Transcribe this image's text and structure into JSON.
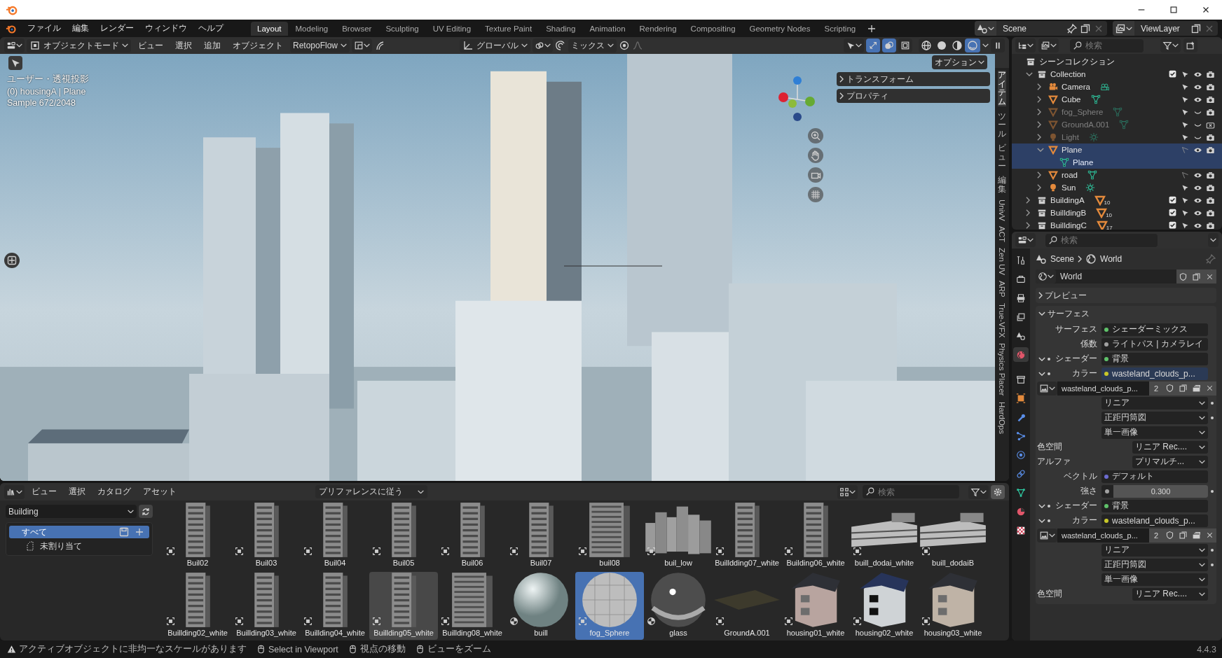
{
  "top_bar": {
    "menus": [
      "ファイル",
      "編集",
      "レンダー",
      "ウィンドウ",
      "ヘルプ"
    ],
    "workspaces": [
      {
        "label": "Layout",
        "selected": true
      },
      {
        "label": "Modeling",
        "selected": false
      },
      {
        "label": "Browser",
        "selected": false
      },
      {
        "label": "Sculpting",
        "selected": false
      },
      {
        "label": "UV Editing",
        "selected": false
      },
      {
        "label": "Texture Paint",
        "selected": false
      },
      {
        "label": "Shading",
        "selected": false
      },
      {
        "label": "Animation",
        "selected": false
      },
      {
        "label": "Rendering",
        "selected": false
      },
      {
        "label": "Compositing",
        "selected": false
      },
      {
        "label": "Geometry Nodes",
        "selected": false
      },
      {
        "label": "Scripting",
        "selected": false
      }
    ],
    "scene": "Scene",
    "view_layer": "ViewLayer"
  },
  "viewport": {
    "header": {
      "mode": "オブジェクトモード",
      "menus": [
        "ビュー",
        "選択",
        "追加",
        "オブジェクト"
      ],
      "addon": "RetopoFlow",
      "orientation": "グローバル",
      "snap": "ミックス",
      "toggles": [
        {
          "kind": "gizmo",
          "on": true
        },
        {
          "kind": "overlay",
          "on": true
        },
        {
          "kind": "xray",
          "on": false
        }
      ],
      "shading": [
        {
          "kind": "wireframe",
          "selected": false
        },
        {
          "kind": "solid",
          "selected": false
        },
        {
          "kind": "material",
          "selected": false
        },
        {
          "kind": "rendered",
          "selected": true
        }
      ]
    },
    "overlay_text": [
      "ユーザー・透視投影",
      "(0) housingA | Plane",
      "Sample 672/2048"
    ],
    "options_button": "オプション",
    "sidebar_panels": [
      {
        "title": "トランスフォーム",
        "expanded": false
      },
      {
        "title": "プロパティ",
        "expanded": false
      }
    ],
    "side_tabs": [
      {
        "label": "アイテム",
        "kind": "stacked",
        "selected": true
      },
      {
        "label": "ツール",
        "kind": "stacked",
        "selected": false
      },
      {
        "label": "ビュー",
        "kind": "stacked",
        "selected": false
      },
      {
        "label": "編集",
        "kind": "stacked",
        "selected": false
      },
      {
        "label": "UnivV",
        "kind": "rotated",
        "selected": false
      },
      {
        "label": "ACT",
        "kind": "rotated",
        "selected": false
      },
      {
        "label": "Zen UV",
        "kind": "rotated",
        "selected": false
      },
      {
        "label": "ARP",
        "kind": "rotated",
        "selected": false
      },
      {
        "label": "True-VFX",
        "kind": "rotated",
        "selected": false
      },
      {
        "label": "Physics Placer",
        "kind": "rotated",
        "selected": false
      },
      {
        "label": "HardOps",
        "kind": "rotated",
        "selected": false
      }
    ]
  },
  "asset_browser": {
    "menus": [
      "ビュー",
      "選択",
      "カタログ",
      "アセット"
    ],
    "import_method": "プリファレンスに従う",
    "search_placeholder": "検索",
    "library": "Building",
    "catalogs": [
      {
        "label": "すべて",
        "selected": true
      },
      {
        "label": "未割り当て",
        "selected": false
      }
    ],
    "assets": [
      {
        "name": "Buil02",
        "kind": "tower",
        "selected": false,
        "hovered": false
      },
      {
        "name": "Buil03",
        "kind": "tower",
        "selected": false,
        "hovered": false
      },
      {
        "name": "Buil04",
        "kind": "tower",
        "selected": false,
        "hovered": false
      },
      {
        "name": "Buil05",
        "kind": "tower",
        "selected": false,
        "hovered": false
      },
      {
        "name": "Buil06",
        "kind": "tower",
        "selected": false,
        "hovered": false
      },
      {
        "name": "Buil07",
        "kind": "tower",
        "selected": false,
        "hovered": false
      },
      {
        "name": "buil08",
        "kind": "block",
        "selected": false,
        "hovered": false
      },
      {
        "name": "buil_low",
        "kind": "cluster",
        "selected": false,
        "hovered": false
      },
      {
        "name": "Builldding07_white",
        "kind": "tower",
        "selected": false,
        "hovered": false
      },
      {
        "name": "Building06_white",
        "kind": "tower",
        "selected": false,
        "hovered": false
      },
      {
        "name": "buill_dodai_white",
        "kind": "wide",
        "selected": false,
        "hovered": false
      },
      {
        "name": "buill_dodaiB",
        "kind": "wide",
        "selected": false,
        "hovered": false
      },
      {
        "name": "Buillding02_white",
        "kind": "tower",
        "selected": false,
        "hovered": false
      },
      {
        "name": "Buillding03_white",
        "kind": "tower",
        "selected": false,
        "hovered": false
      },
      {
        "name": "Buillding04_white",
        "kind": "tower",
        "selected": false,
        "hovered": false
      },
      {
        "name": "Buillding05_white",
        "kind": "tower",
        "selected": false,
        "hovered": true
      },
      {
        "name": "Buillding08_white",
        "kind": "block",
        "selected": false,
        "hovered": false
      },
      {
        "name": "buill",
        "kind": "sphere",
        "selected": false,
        "hovered": false
      },
      {
        "name": "fog_Sphere",
        "kind": "faceted",
        "selected": true,
        "hovered": false
      },
      {
        "name": "glass",
        "kind": "glass",
        "selected": false,
        "hovered": false
      },
      {
        "name": "GroundA.001",
        "kind": "ground",
        "selected": false,
        "hovered": false
      },
      {
        "name": "housing01_white",
        "kind": "house_a",
        "selected": false,
        "hovered": false
      },
      {
        "name": "housing02_white",
        "kind": "house_b",
        "selected": false,
        "hovered": false
      },
      {
        "name": "housing03_white",
        "kind": "house_c",
        "selected": false,
        "hovered": false
      }
    ]
  },
  "outliner": {
    "search_placeholder": "検索",
    "tree": [
      {
        "name": "シーンコレクション",
        "kind": "scene_collection",
        "children": [
          {
            "name": "Collection",
            "kind": "collection",
            "expanded": true,
            "checked": true,
            "selected": false,
            "selectable": true,
            "visible": true,
            "renderable": true,
            "children": [
              {
                "name": "Camera",
                "kind": "camera",
                "data_icon": true,
                "expanded": false,
                "selected": false,
                "selectable": true,
                "visible": true,
                "renderable": true
              },
              {
                "name": "Cube",
                "kind": "mesh",
                "data_icon": true,
                "expanded": false,
                "selected": false,
                "selectable": true,
                "visible": true,
                "renderable": true
              },
              {
                "name": "fog_Sphere",
                "kind": "mesh",
                "data_icon": true,
                "expanded": false,
                "selected": false,
                "selectable": true,
                "visible": false,
                "renderable": true
              },
              {
                "name": "GroundA.001",
                "kind": "mesh",
                "data_icon": true,
                "expanded": false,
                "selected": false,
                "selectable": true,
                "visible": false,
                "renderable": false
              },
              {
                "name": "Light",
                "kind": "light",
                "data_icon": true,
                "expanded": false,
                "selected": false,
                "selectable": true,
                "visible": false,
                "renderable": true
              },
              {
                "name": "Plane",
                "kind": "mesh",
                "data_icon": false,
                "expanded": true,
                "selected": true,
                "selectable": false,
                "visible": true,
                "renderable": true,
                "children": [
                  {
                    "name": "Plane",
                    "kind": "mesh_data",
                    "selected": true
                  }
                ]
              },
              {
                "name": "road",
                "kind": "mesh",
                "data_icon": true,
                "expanded": false,
                "selected": false,
                "selectable": false,
                "visible": true,
                "renderable": true
              },
              {
                "name": "Sun",
                "kind": "light",
                "data_icon": true,
                "expanded": false,
                "selected": false,
                "selectable": true,
                "visible": true,
                "renderable": true
              }
            ]
          },
          {
            "name": "BuildingA",
            "kind": "collection",
            "count": "10",
            "expanded": false,
            "checked": true,
            "selected": false,
            "selectable": true,
            "visible": true,
            "renderable": true
          },
          {
            "name": "BuilldingB",
            "kind": "collection",
            "count": "10",
            "expanded": false,
            "checked": true,
            "selected": false,
            "selectable": true,
            "visible": true,
            "renderable": true
          },
          {
            "name": "BuilldingC",
            "kind": "collection",
            "count": "17",
            "expanded": false,
            "checked": true,
            "selected": false,
            "selectable": true,
            "visible": true,
            "renderable": true
          }
        ]
      }
    ]
  },
  "properties": {
    "search_placeholder": "検索",
    "tabs": [
      {
        "kind": "tool",
        "selected": false
      },
      {
        "kind": "render",
        "selected": false
      },
      {
        "kind": "output",
        "selected": false
      },
      {
        "kind": "view_layer",
        "selected": false
      },
      {
        "kind": "scene",
        "selected": false
      },
      {
        "kind": "world",
        "selected": true
      },
      {
        "kind": "collection",
        "selected": false
      },
      {
        "kind": "object",
        "selected": false
      },
      {
        "kind": "modifier",
        "selected": false
      },
      {
        "kind": "particles",
        "selected": false
      },
      {
        "kind": "physics",
        "selected": false
      },
      {
        "kind": "constraints",
        "selected": false
      },
      {
        "kind": "data",
        "selected": false
      },
      {
        "kind": "material",
        "selected": false
      },
      {
        "kind": "texture",
        "selected": false
      }
    ],
    "breadcrumb": [
      "Scene",
      "World"
    ],
    "world": "World",
    "panels": [
      {
        "title": "プレビュー",
        "expanded": false
      },
      {
        "title": "サーフェス",
        "expanded": true
      }
    ],
    "rows": [
      {
        "kind": "socket",
        "label": "サーフェス",
        "color": "#5fc26a",
        "value": "シェーダーミックス",
        "highlighted": false
      },
      {
        "kind": "socket",
        "label": "係数",
        "color": "#a1a1a1",
        "value": "ライトパス | カメラレイ",
        "highlighted": false
      },
      {
        "kind": "socket",
        "label": "シェーダー",
        "color": "#5fc26a",
        "value": "背景",
        "expanded": true,
        "highlighted": false
      },
      {
        "kind": "socket",
        "label": "カラー",
        "color": "#c7c729",
        "value": "wasteland_clouds_p...",
        "expanded": true,
        "highlighted": true
      },
      {
        "kind": "image",
        "value": "wasteland_clouds_p...",
        "users": "2"
      },
      {
        "kind": "dropdown",
        "value": "リニア",
        "animatable": true
      },
      {
        "kind": "dropdown",
        "value": "正距円筒図",
        "animatable": true
      },
      {
        "kind": "dropdown",
        "value": "単一画像",
        "animatable": false
      },
      {
        "kind": "labeled_dropdown",
        "label": "色空間",
        "value": "リニア Rec...."
      },
      {
        "kind": "labeled_dropdown",
        "label": "アルファ",
        "value": "プリマルチ..."
      },
      {
        "kind": "socket",
        "label": "ベクトル",
        "color": "#6c6cd0",
        "value": "デフォルト",
        "highlighted": false
      },
      {
        "kind": "number",
        "label": "強さ",
        "color": "#a1a1a1",
        "value": "0.300",
        "animatable": true
      },
      {
        "kind": "socket",
        "label": "シェーダー",
        "color": "#5fc26a",
        "value": "背景",
        "expanded": true,
        "highlighted": false
      },
      {
        "kind": "socket",
        "label": "カラー",
        "color": "#c7c729",
        "value": "wasteland_clouds_p...",
        "expanded": true,
        "highlighted": false
      },
      {
        "kind": "image",
        "value": "wasteland_clouds_p...",
        "users": "2"
      },
      {
        "kind": "dropdown",
        "value": "リニア",
        "animatable": true
      },
      {
        "kind": "dropdown",
        "value": "正距円筒図",
        "animatable": true
      },
      {
        "kind": "dropdown",
        "value": "単一画像",
        "animatable": false
      },
      {
        "kind": "labeled_dropdown",
        "label": "色空間",
        "value": "リニア Rec...."
      }
    ]
  },
  "status_bar": {
    "items": [
      {
        "kind": "warning",
        "text": "アクティブオブジェクトに非均一なスケールがあります"
      },
      {
        "kind": "mouse",
        "text": "Select in Viewport"
      },
      {
        "kind": "mouse",
        "text": "視点の移動"
      },
      {
        "kind": "mouse",
        "text": "ビューをズーム"
      }
    ],
    "version": "4.4.3"
  }
}
